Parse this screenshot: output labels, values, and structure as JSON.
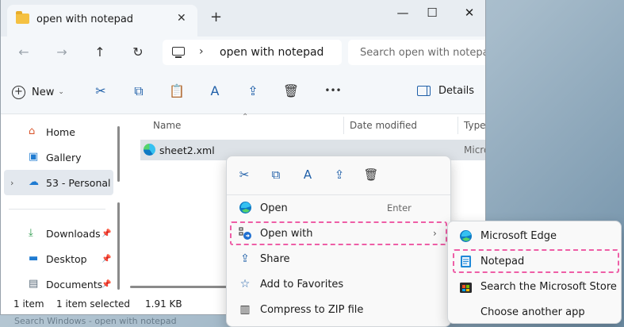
{
  "window": {
    "tab_title": "open with notepad",
    "tab_close": "✕",
    "new_tab": "+",
    "minimize": "—",
    "maximize": "☐",
    "close": "✕"
  },
  "nav": {
    "back": "←",
    "forward": "→",
    "up": "↑",
    "refresh": "↻",
    "breadcrumb_sep": "›",
    "path": "open with notepad",
    "search_placeholder": "Search open with notepad"
  },
  "toolbar": {
    "new_label": "New",
    "new_chevron": "⌄",
    "cut": "✂",
    "copy": "⧉",
    "paste": "📋",
    "rename": "A",
    "share": "⇪",
    "delete": "🗑",
    "more": "•••",
    "details_label": "Details"
  },
  "sidebar": {
    "items": [
      {
        "label": "Home",
        "icon": "home-icon",
        "glyph": "⌂"
      },
      {
        "label": "Gallery",
        "icon": "gallery-icon",
        "glyph": "▣"
      },
      {
        "label": "53 - Personal",
        "icon": "cloud-icon",
        "glyph": "☁",
        "expander": "›"
      },
      {
        "label": "Downloads",
        "icon": "download-icon",
        "glyph": "⤓",
        "pin": "📌"
      },
      {
        "label": "Desktop",
        "icon": "desktop-icon",
        "glyph": "▬",
        "pin": "📌"
      },
      {
        "label": "Documents",
        "icon": "documents-icon",
        "glyph": "▤",
        "pin": "📌"
      }
    ]
  },
  "filelist": {
    "columns": [
      "Name",
      "Date modified",
      "Type"
    ],
    "sort_indicator": "⌃",
    "files": [
      {
        "name": "sheet2.xml",
        "type": "Micro"
      }
    ]
  },
  "status": {
    "count": "1 item",
    "selected": "1 item selected",
    "size": "1.91 KB"
  },
  "context_menu": {
    "quick": {
      "cut": "✂",
      "copy": "⧉",
      "rename": "A",
      "share": "⇪",
      "delete": "🗑"
    },
    "items": [
      {
        "label": "Open",
        "shortcut": "Enter"
      },
      {
        "label": "Open with",
        "arrow": "›"
      },
      {
        "label": "Share"
      },
      {
        "label": "Add to Favorites"
      },
      {
        "label": "Compress to ZIP file"
      }
    ]
  },
  "submenu": {
    "items": [
      {
        "label": "Microsoft Edge"
      },
      {
        "label": "Notepad"
      },
      {
        "label": "Search the Microsoft Store"
      },
      {
        "label": "Choose another app"
      }
    ]
  },
  "taskbar_text": "Search Windows - open with notepad",
  "colors": {
    "highlight": "#ee5ea6",
    "accent": "#1f5fa8",
    "selection": "#dde2e7"
  }
}
